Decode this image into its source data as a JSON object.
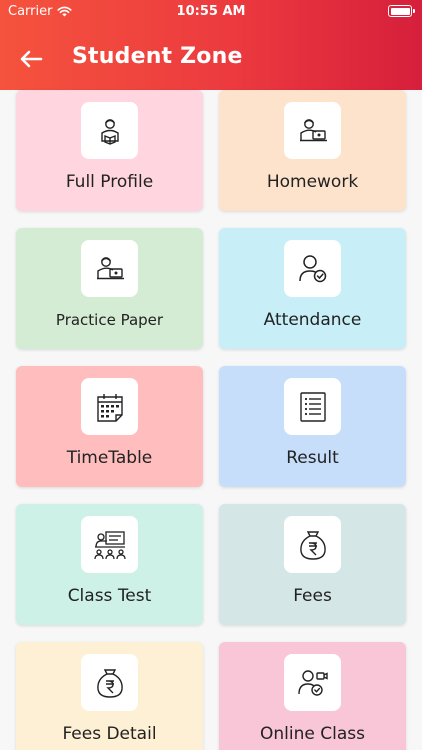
{
  "status_bar": {
    "carrier": "Carrier",
    "time": "10:55 AM"
  },
  "header": {
    "title": "Student Zone"
  },
  "tiles": [
    {
      "label": "Full Profile",
      "color": "#ffd6e0",
      "icon": "student-reading-icon"
    },
    {
      "label": "Homework",
      "color": "#fde3cc",
      "icon": "student-laptop-icon"
    },
    {
      "label": "Practice Paper",
      "color": "#d3ecd3",
      "icon": "student-laptop-icon"
    },
    {
      "label": "Attendance",
      "color": "#c8eff8",
      "icon": "user-check-icon"
    },
    {
      "label": "TimeTable",
      "color": "#ffbdbd",
      "icon": "calendar-icon"
    },
    {
      "label": "Result",
      "color": "#c7defa",
      "icon": "list-document-icon"
    },
    {
      "label": "Class Test",
      "color": "#cdf1e6",
      "icon": "classroom-icon"
    },
    {
      "label": "Fees",
      "color": "#d5e6e6",
      "icon": "rupee-bag-icon"
    },
    {
      "label": "Fees Detail",
      "color": "#fdf0d4",
      "icon": "rupee-bag-icon"
    },
    {
      "label": "Online Class",
      "color": "#f8c6d6",
      "icon": "video-user-icon"
    }
  ]
}
